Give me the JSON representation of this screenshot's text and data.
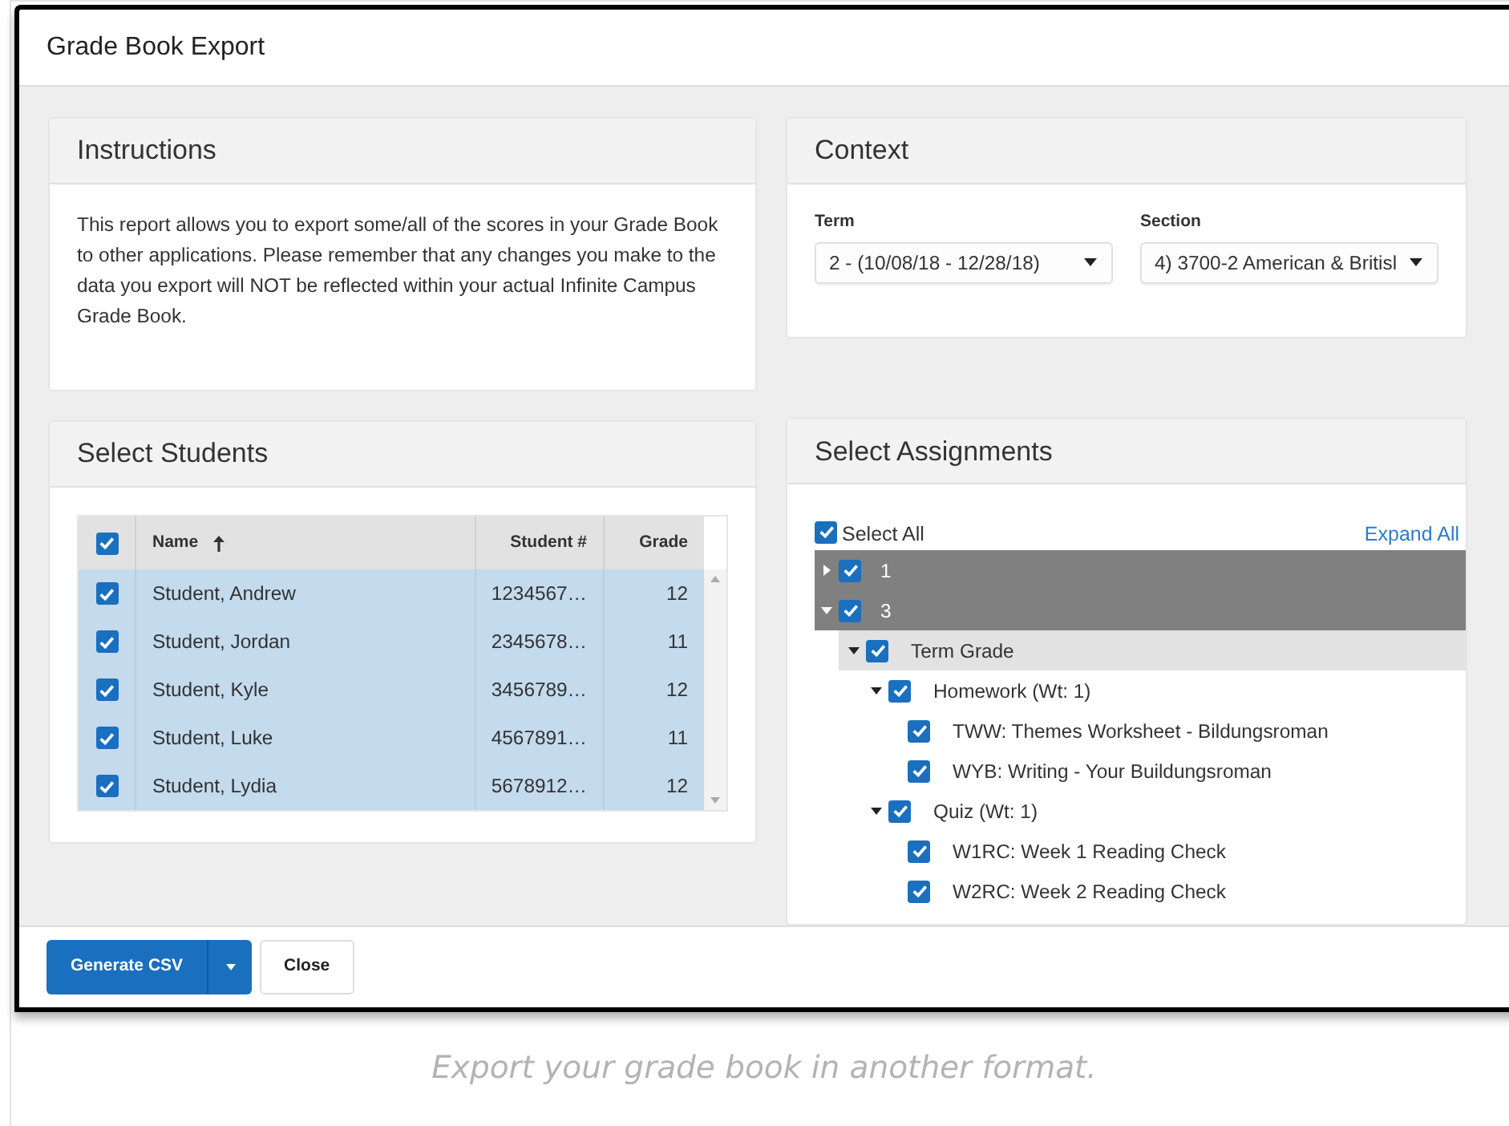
{
  "window": {
    "title": "Grade Book Export"
  },
  "instructions": {
    "title": "Instructions",
    "text": "This report allows you to export some/all of the scores in your Grade Book to other applications. Please remember that any changes you make to the data you export will NOT be reflected within your actual Infinite Campus Grade Book."
  },
  "context": {
    "title": "Context",
    "fields": [
      {
        "label": "Term",
        "value": "2 - (10/08/18 - 12/28/18)"
      },
      {
        "label": "Section",
        "value": "4) 3700-2 American & Britisl"
      }
    ]
  },
  "students": {
    "title": "Select Students",
    "all_checked": true,
    "columns": [
      {
        "label": "Name",
        "sorted": true
      },
      {
        "label": "Student #",
        "sorted": false
      },
      {
        "label": "Grade",
        "sorted": false
      }
    ],
    "rows": [
      {
        "checked": true,
        "selected": true,
        "cells": [
          "Student, Andrew",
          "1234567…",
          "12"
        ]
      },
      {
        "checked": true,
        "selected": true,
        "cells": [
          "Student, Jordan",
          "2345678…",
          "11"
        ]
      },
      {
        "checked": true,
        "selected": true,
        "cells": [
          "Student, Kyle",
          "3456789…",
          "12"
        ]
      },
      {
        "checked": true,
        "selected": true,
        "cells": [
          "Student, Luke",
          "4567891…",
          "11"
        ]
      },
      {
        "checked": true,
        "selected": true,
        "cells": [
          "Student, Lydia",
          "5678912…",
          "12"
        ]
      }
    ]
  },
  "assignments": {
    "title": "Select Assignments",
    "select_all": {
      "label": "Select All",
      "checked": true
    },
    "expand_all": "Expand All",
    "tree": [
      {
        "label": "1",
        "checked": true,
        "expanded": false,
        "selected": true
      },
      {
        "label": "3",
        "checked": true,
        "expanded": true,
        "selected": true,
        "children": [
          {
            "label": "Term Grade",
            "checked": true,
            "expanded": true,
            "kind": "task",
            "children": [
              {
                "label": "Homework (Wt: 1)",
                "checked": true,
                "expanded": true,
                "children": [
                  {
                    "label": "TWW: Themes Worksheet - Bildungsroman",
                    "checked": true
                  },
                  {
                    "label": "WYB: Writing - Your Buildungsroman",
                    "checked": true
                  }
                ]
              },
              {
                "label": "Quiz (Wt: 1)",
                "checked": true,
                "expanded": true,
                "children": [
                  {
                    "label": "W1RC: Week 1 Reading Check",
                    "checked": true
                  },
                  {
                    "label": "W2RC: Week 2 Reading Check",
                    "checked": true
                  }
                ]
              }
            ]
          }
        ]
      }
    ]
  },
  "footer": {
    "buttons": [
      {
        "label": "Generate CSV",
        "kind": "primary"
      },
      {
        "label": "Close",
        "kind": "secondary"
      }
    ]
  },
  "caption": "Export your grade book in another format."
}
